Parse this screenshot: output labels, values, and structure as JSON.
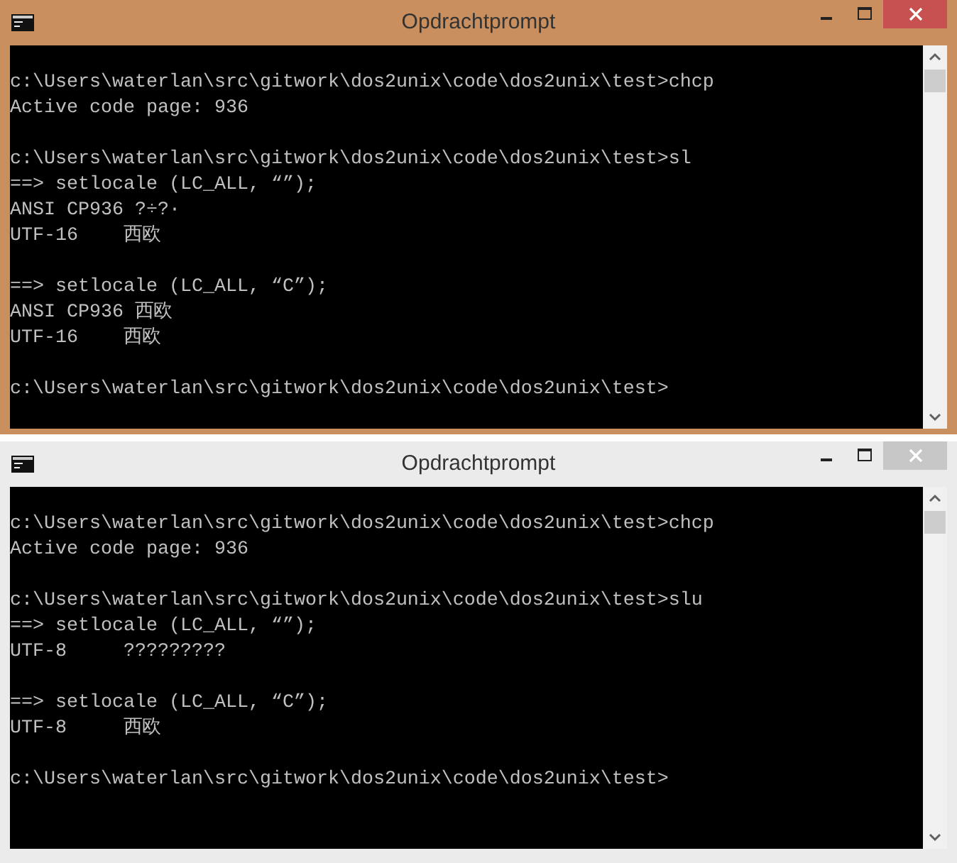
{
  "windows": [
    {
      "title": "Opdrachtprompt",
      "active": true,
      "blocks": [
        [
          "c:\\Users\\waterlan\\src\\gitwork\\dos2unix\\code\\dos2unix\\test>chcp",
          "Active code page: 936"
        ],
        [
          "c:\\Users\\waterlan\\src\\gitwork\\dos2unix\\code\\dos2unix\\test>sl",
          "==> setlocale (LC_ALL, “”);",
          "ANSI CP936 ?÷?·",
          "UTF-16    西欧"
        ],
        [
          "==> setlocale (LC_ALL, “C”);",
          "ANSI CP936 西欧",
          "UTF-16    西欧"
        ],
        [
          "c:\\Users\\waterlan\\src\\gitwork\\dos2unix\\code\\dos2unix\\test>"
        ]
      ]
    },
    {
      "title": "Opdrachtprompt",
      "active": false,
      "blocks": [
        [
          "c:\\Users\\waterlan\\src\\gitwork\\dos2unix\\code\\dos2unix\\test>chcp",
          "Active code page: 936"
        ],
        [
          "c:\\Users\\waterlan\\src\\gitwork\\dos2unix\\code\\dos2unix\\test>slu",
          "==> setlocale (LC_ALL, “”);",
          "UTF-8     ?????????"
        ],
        [
          "==> setlocale (LC_ALL, “C”);",
          "UTF-8     西欧"
        ],
        [
          "c:\\Users\\waterlan\\src\\gitwork\\dos2unix\\code\\dos2unix\\test>"
        ]
      ]
    }
  ]
}
